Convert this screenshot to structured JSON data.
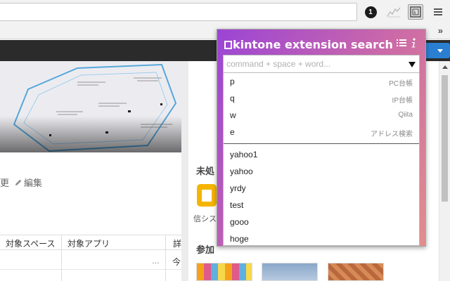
{
  "browser": {
    "badge_count": "1"
  },
  "bookmarks": {
    "more_label": "»"
  },
  "page": {
    "help_label": "?",
    "edit_cut": "更",
    "edit_label": "編集",
    "table_headers": [
      "対象スペース",
      "対象アプリ",
      "詳"
    ],
    "row_dots": "…",
    "row_partial": "今",
    "label_mi": "未処",
    "app_label": "信シス",
    "label_san": "参加"
  },
  "popup": {
    "title": "kintone extension search",
    "search_placeholder": "command + space + word...",
    "commands": [
      {
        "key": "p",
        "desc": "PC台帳"
      },
      {
        "key": "q",
        "desc": "IP台帳"
      },
      {
        "key": "w",
        "desc": "Qiita"
      },
      {
        "key": "e",
        "desc": "アドレス検索"
      }
    ],
    "bookmarks": [
      {
        "key": "yahoo1"
      },
      {
        "key": "yahoo"
      },
      {
        "key": "yrdy"
      },
      {
        "key": "test"
      },
      {
        "key": "gooo"
      },
      {
        "key": "hoge"
      }
    ]
  },
  "colors": {
    "popup_gradient_start": "#9b44d6",
    "popup_gradient_end": "#e08e8d",
    "help_button": "#2a7fd1",
    "header_dark": "#2b2b2b"
  }
}
